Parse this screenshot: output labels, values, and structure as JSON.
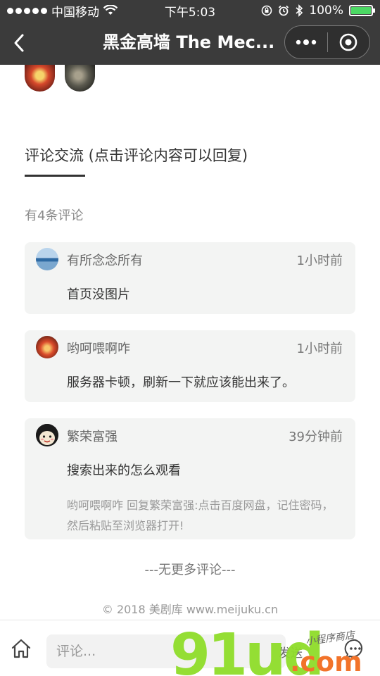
{
  "status_bar": {
    "carrier": "中国移动",
    "time": "下午5:03",
    "battery": "100%",
    "battery_level": 1.0
  },
  "nav": {
    "title": "黑金高墙 The Mec...",
    "icons": {
      "back": "chevron-left-icon",
      "more": "more-dots-icon",
      "close": "target-close-icon"
    }
  },
  "section": {
    "title": "评论交流 (点击评论内容可以回复)",
    "count_text": "有4条评论"
  },
  "comments": [
    {
      "name": "有所念念所有",
      "time": "1小时前",
      "text": "首页没图片"
    },
    {
      "name": "哟呵喂啊咋",
      "time": "1小时前",
      "text": "服务器卡顿，刷新一下就应该能出来了。"
    },
    {
      "name": "繁荣富强",
      "time": "39分钟前",
      "text": "搜索出来的怎么观看",
      "reply": "哟呵喂啊咋 回复繁荣富强:点击百度网盘，记住密码，然后粘贴至浏览器打开!"
    }
  ],
  "footer": {
    "no_more": "---无更多评论---",
    "copyright": "© 2018 美剧库 www.meijuku.cn"
  },
  "bottom_bar": {
    "input_placeholder": "评论...",
    "send_label": "发送"
  },
  "watermark": {
    "main": "91ud",
    "suffix": ".com",
    "small": "小程序商店"
  },
  "colors": {
    "nav_bg": "#3b3b3b",
    "card_bg": "#f3f4f3",
    "battery_green": "#4cd964",
    "watermark_green": "#8fdd2a",
    "watermark_orange": "#f2732a"
  }
}
